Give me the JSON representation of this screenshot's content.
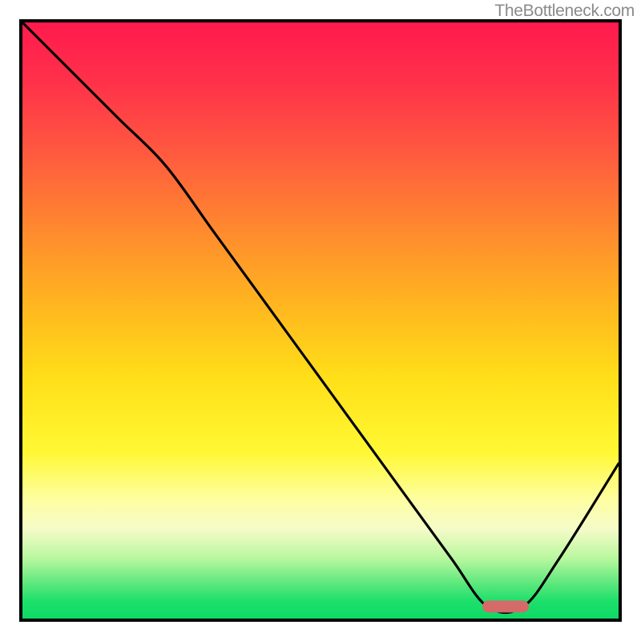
{
  "watermark": "TheBottleneck.com",
  "chart_data": {
    "type": "line",
    "title": "",
    "xlabel": "",
    "ylabel": "",
    "xlim": [
      0,
      100
    ],
    "ylim": [
      0,
      100
    ],
    "grid": false,
    "legend": false,
    "background_gradient": {
      "stops": [
        {
          "pos": 0,
          "color": "#ff1a4d"
        },
        {
          "pos": 0.5,
          "color": "#ffd41f"
        },
        {
          "pos": 0.82,
          "color": "#fefea1"
        },
        {
          "pos": 1.0,
          "color": "#0dd965"
        }
      ]
    },
    "series": [
      {
        "name": "bottleneck-curve",
        "x": [
          0,
          8,
          16,
          24,
          32,
          40,
          48,
          56,
          64,
          72,
          78,
          84,
          90,
          100
        ],
        "y": [
          100,
          92,
          84,
          76,
          65,
          54,
          43,
          32,
          21,
          10,
          2,
          2,
          10,
          26
        ]
      }
    ],
    "marker": {
      "name": "optimal-range",
      "x": 81,
      "y": 2,
      "color": "#d46a6a"
    }
  }
}
